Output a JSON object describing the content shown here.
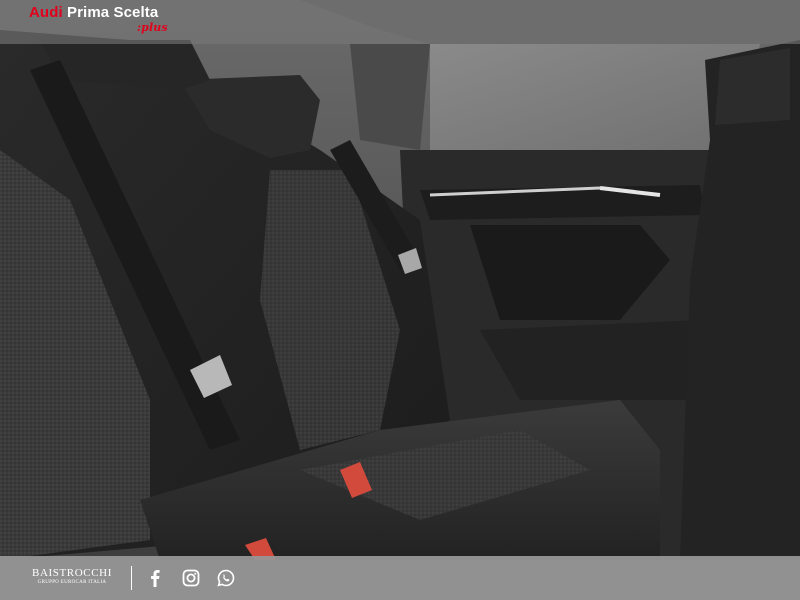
{
  "header": {
    "brand_audi": "Audi",
    "brand_rest": "Prima Scelta",
    "brand_plus": ":plus"
  },
  "footer": {
    "dealer_name": "BAISTROCCHI",
    "dealer_sub": "GRUPPO EUROCAR ITALIA",
    "social": [
      "facebook-icon",
      "instagram-icon",
      "whatsapp-icon"
    ]
  },
  "colors": {
    "accent": "#e3001b",
    "header_bg": "#787878",
    "footer_bg": "#969696"
  }
}
